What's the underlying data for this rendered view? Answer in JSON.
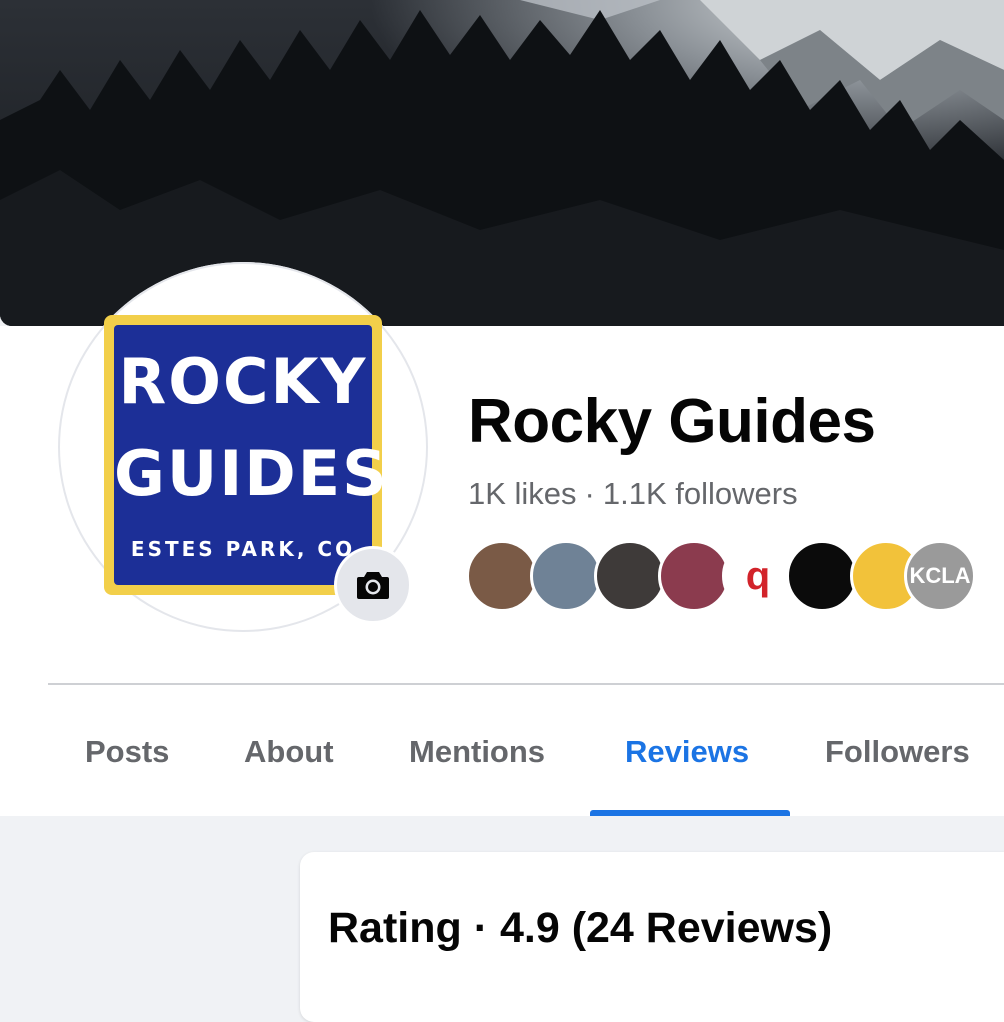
{
  "cover": {
    "alt": "cover-photo"
  },
  "page": {
    "name": "Rocky Guides",
    "likes": "1K likes",
    "separator": "·",
    "followers": "1.1K followers"
  },
  "logo": {
    "line1": "ROCKY",
    "line2": "GUIDES",
    "line3": "ESTES PARK, CO"
  },
  "friends": [
    {
      "initials": "",
      "color": "#7a5a46"
    },
    {
      "initials": "",
      "color": "#6f8296"
    },
    {
      "initials": "",
      "color": "#3e3a39"
    },
    {
      "initials": "",
      "color": "#8b3b4e"
    },
    {
      "initials": "q",
      "color": "#ffffff"
    },
    {
      "initials": "",
      "color": "#0b0b0b"
    },
    {
      "initials": "",
      "color": "#f2c23a"
    },
    {
      "initials": "KCLA",
      "color": "#9a9a9a"
    }
  ],
  "tabs": [
    {
      "label": "Posts"
    },
    {
      "label": "About"
    },
    {
      "label": "Mentions"
    },
    {
      "label": "Reviews"
    },
    {
      "label": "Followers"
    }
  ],
  "active_tab": "Reviews",
  "rating": {
    "text": "Rating · 4.9 (24 Reviews)"
  },
  "colors": {
    "accent": "#1b74e4",
    "logo_blue": "#1c2f97",
    "logo_yellow": "#f2cf4a"
  }
}
